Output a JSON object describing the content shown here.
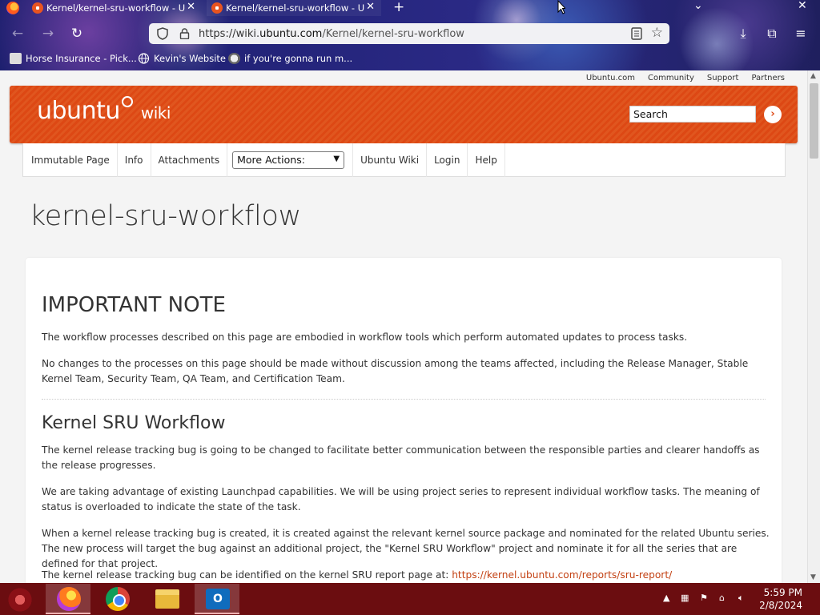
{
  "browser": {
    "tabs": [
      {
        "title": "Kernel/kernel-sru-workflow - U",
        "active": false
      },
      {
        "title": "Kernel/kernel-sru-workflow - U",
        "active": true
      }
    ],
    "new_tab_label": "+",
    "url": {
      "prefix": "https://wiki.",
      "domain": "ubuntu.com",
      "path": "/Kernel/kernel-sru-workflow"
    },
    "bookmarks": [
      {
        "label": "Horse Insurance - Pick...",
        "icon": "bookmark-page-icon"
      },
      {
        "label": "Kevin's Website",
        "icon": "globe-icon"
      },
      {
        "label": "if you're gonna run m...",
        "icon": "bookmark-face-icon"
      }
    ]
  },
  "page": {
    "top_links": [
      "Ubuntu.com",
      "Community",
      "Support",
      "Partners"
    ],
    "logo_text": "ubuntu",
    "logo_suffix": "wiki",
    "search_value": "Search",
    "actions": [
      "Immutable Page",
      "Info",
      "Attachments"
    ],
    "more_actions": "More Actions:",
    "actions_right": [
      "Ubuntu Wiki",
      "Login",
      "Help"
    ],
    "title": "kernel-sru-workflow",
    "content": {
      "h1": "IMPORTANT NOTE",
      "p1": "The workflow processes described on this page are embodied in workflow tools which perform automated updates to process tasks.",
      "p2": "No changes to the processes on this page should be made without discussion among the teams affected, including the Release Manager, Stable Kernel Team, Security Team, QA Team, and Certification Team.",
      "h2": "Kernel SRU Workflow",
      "p3": "The kernel release tracking bug is going to be changed to facilitate better communication between the responsible parties and clearer handoffs as the release progresses.",
      "p4": "We are taking advantage of existing Launchpad capabilities. We will be using project series to represent individual workflow tasks. The meaning of status is overloaded to indicate the state of the task.",
      "p5": "When a kernel release tracking bug is created, it is created against the relevant kernel source package and nominated for the related Ubuntu series. The new process will target the bug against an additional project, the \"Kernel SRU Workflow\" project and nominate it for all the series that are defined for that project.",
      "p6_prefix": "The kernel release tracking bug can be identified on the kernel SRU report page at: ",
      "p6_link": "https://kernel.ubuntu.com/reports/sru-report/"
    }
  },
  "taskbar": {
    "apps": [
      "firefox-icon",
      "chrome-icon",
      "file-explorer-icon",
      "outlook-icon"
    ],
    "clock_time": "5:59 PM",
    "clock_date": "2/8/2024",
    "outlook_letter": "O"
  },
  "colors": {
    "ubuntu_orange": "#dd4814",
    "taskbar": "#6b0d10",
    "link": "#c34113"
  }
}
